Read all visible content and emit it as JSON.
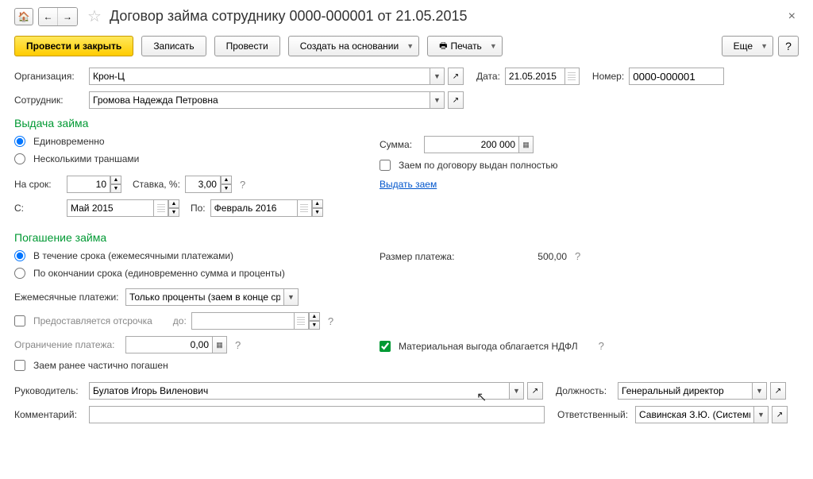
{
  "header": {
    "title": "Договор займа сотруднику 0000-000001 от 21.05.2015"
  },
  "toolbar": {
    "post_close": "Провести и закрыть",
    "save": "Записать",
    "post": "Провести",
    "create_based": "Создать на основании",
    "print": "Печать",
    "more": "Еще",
    "help": "?"
  },
  "fields": {
    "org_label": "Организация:",
    "org_value": "Крон-Ц",
    "date_label": "Дата:",
    "date_value": "21.05.2015",
    "number_label": "Номер:",
    "number_value": "0000-000001",
    "employee_label": "Сотрудник:",
    "employee_value": "Громова Надежда Петровна"
  },
  "issue": {
    "title": "Выдача займа",
    "once": "Единовременно",
    "tranches": "Несколькими траншами",
    "amount_label": "Сумма:",
    "amount_value": "200 000",
    "fully_issued": "Заем по договору выдан полностью",
    "term_label": "На срок:",
    "term_value": "10",
    "rate_label": "Ставка, %:",
    "rate_value": "3,00",
    "issue_link": "Выдать заем",
    "from_label": "С:",
    "from_value": "Май 2015",
    "to_label": "По:",
    "to_value": "Февраль 2016"
  },
  "repay": {
    "title": "Погашение займа",
    "during": "В течение срока (ежемесячными платежами)",
    "end": "По окончании срока (единовременно сумма и проценты)",
    "payment_label": "Размер платежа:",
    "payment_value": "500,00",
    "monthly_label": "Ежемесячные платежи:",
    "monthly_value": "Только проценты (заем в конце срока)",
    "deferral": "Предоставляется отсрочка",
    "deferral_to": "до:",
    "limit_label": "Ограничение платежа:",
    "limit_value": "0,00",
    "ndfl": "Материальная выгода облагается НДФЛ",
    "partial": "Заем ранее частично погашен"
  },
  "footer": {
    "manager_label": "Руководитель:",
    "manager_value": "Булатов Игорь Виленович",
    "position_label": "Должность:",
    "position_value": "Генеральный директор",
    "comment_label": "Комментарий:",
    "responsible_label": "Ответственный:",
    "responsible_value": "Савинская З.Ю. (Системный прог"
  }
}
